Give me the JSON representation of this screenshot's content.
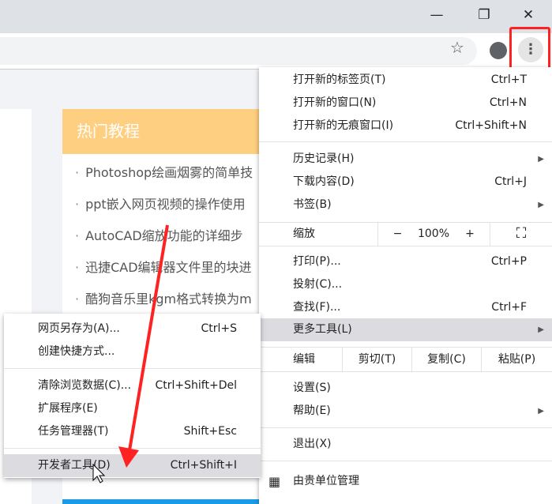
{
  "window": {
    "minimize": "—",
    "restore": "❐",
    "close": "✕"
  },
  "page": {
    "hot_title": "热门教程",
    "items": [
      "Photoshop绘画烟雾的简单技",
      "ppt嵌入网页视频的操作使用",
      "AutoCAD缩放功能的详细步",
      "迅捷CAD编辑器文件里的块进",
      "酷狗音乐里kgm格式转换为m"
    ]
  },
  "menu": {
    "new_tab": {
      "label": "打开新的标签页(T)",
      "shortcut": "Ctrl+T"
    },
    "new_window": {
      "label": "打开新的窗口(N)",
      "shortcut": "Ctrl+N"
    },
    "incognito": {
      "label": "打开新的无痕窗口(I)",
      "shortcut": "Ctrl+Shift+N"
    },
    "history": {
      "label": "历史记录(H)"
    },
    "downloads": {
      "label": "下载内容(D)",
      "shortcut": "Ctrl+J"
    },
    "bookmarks": {
      "label": "书签(B)"
    },
    "zoom": {
      "label": "缩放",
      "minus": "−",
      "value": "100%",
      "plus": "+",
      "fullscreen": "⛶"
    },
    "print": {
      "label": "打印(P)...",
      "shortcut": "Ctrl+P"
    },
    "cast": {
      "label": "投射(C)..."
    },
    "find": {
      "label": "查找(F)...",
      "shortcut": "Ctrl+F"
    },
    "more_tools": {
      "label": "更多工具(L)"
    },
    "edit": {
      "label": "编辑",
      "cut": "剪切(T)",
      "copy": "复制(C)",
      "paste": "粘贴(P)"
    },
    "settings": {
      "label": "设置(S)"
    },
    "help": {
      "label": "帮助(E)"
    },
    "exit": {
      "label": "退出(X)"
    },
    "managed": {
      "label": "由贵单位管理"
    }
  },
  "submenu": {
    "save_as": {
      "label": "网页另存为(A)...",
      "shortcut": "Ctrl+S"
    },
    "shortcut": {
      "label": "创建快捷方式..."
    },
    "clear": {
      "label": "清除浏览数据(C)...",
      "shortcut": "Ctrl+Shift+Del"
    },
    "extensions": {
      "label": "扩展程序(E)"
    },
    "task_manager": {
      "label": "任务管理器(T)",
      "shortcut": "Shift+Esc"
    },
    "devtools": {
      "label": "开发者工具(D)",
      "shortcut": "Ctrl+Shift+I"
    }
  }
}
